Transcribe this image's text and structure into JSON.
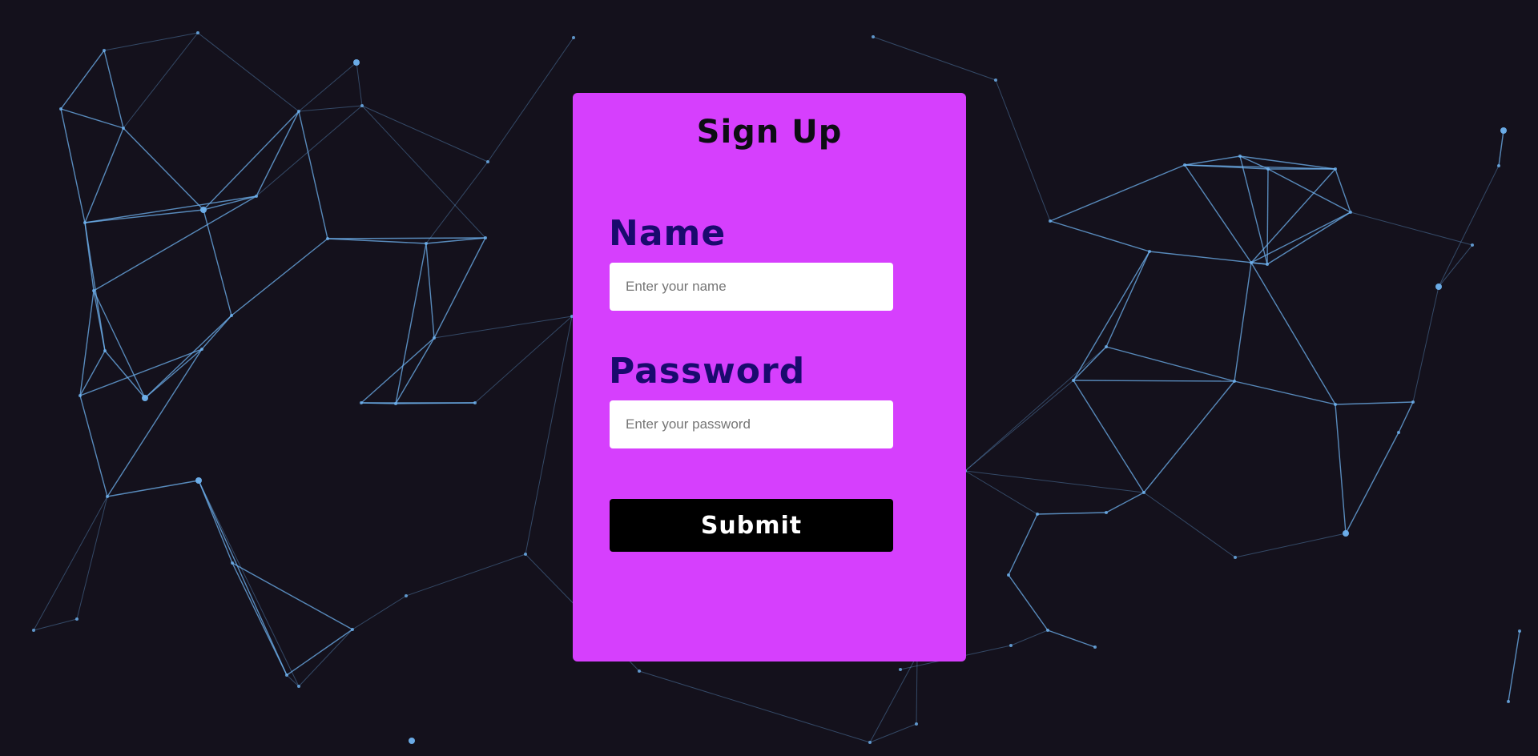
{
  "form": {
    "title": "Sign Up",
    "name_label": "Name",
    "name_placeholder": "Enter your name",
    "password_label": "Password",
    "password_placeholder": "Enter your password",
    "submit_label": "Submit"
  },
  "colors": {
    "background": "#14111c",
    "card": "#d63ffd",
    "label": "#1a0a6e",
    "network": "#6fb3f0"
  }
}
